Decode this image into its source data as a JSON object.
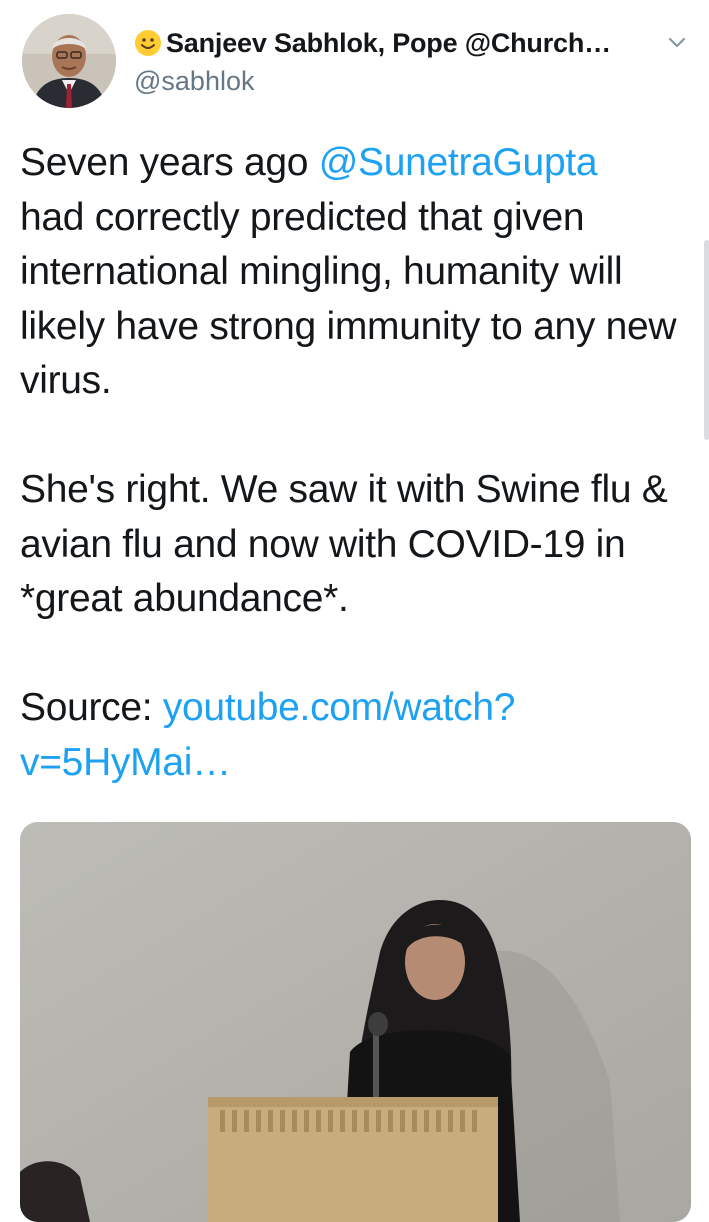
{
  "tweet": {
    "author": {
      "display_name": "Sanjeev Sabhlok, Pope @Church…",
      "handle": "@sabhlok",
      "avatar_icon": "profile-photo"
    },
    "menu_icon": "chevron-down-icon",
    "text": {
      "line1_prefix": "Seven years ago ",
      "mention": "@SunetraGupta",
      "line1_rest": "had correctly predicted that given international mingling, humanity will likely have strong immunity to any new virus.",
      "para2": "She's right. We saw it with Swine flu & avian flu and now with COVID-19 in *great abundance*.",
      "source_label": "Source: ",
      "source_link": "youtube.com/watch?v=5HyMai…"
    },
    "media": {
      "type": "video-thumbnail"
    }
  },
  "colors": {
    "link": "#1da1f2",
    "text": "#14171a",
    "secondary": "#657786"
  }
}
